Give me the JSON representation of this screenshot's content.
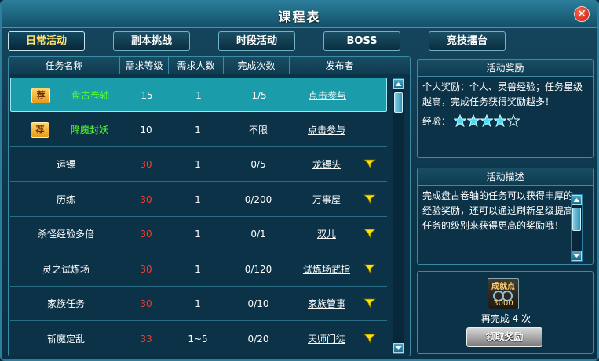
{
  "window": {
    "title": "课程表",
    "close_label": "✕"
  },
  "tabs": [
    {
      "label": "日常活动",
      "active": true
    },
    {
      "label": "副本挑战",
      "active": false
    },
    {
      "label": "时段活动",
      "active": false
    },
    {
      "label": "BOSS",
      "active": false
    },
    {
      "label": "竞技擂台",
      "active": false
    }
  ],
  "table": {
    "columns": [
      "任务名称",
      "需求等级",
      "需求人数",
      "完成次数",
      "发布者"
    ],
    "rows": [
      {
        "badge": "荐",
        "name": "盘古卷轴",
        "level": "15",
        "people": "1",
        "count": "1/5",
        "publisher": "点击参与",
        "flag": false
      },
      {
        "badge": "荐",
        "name": "降魔封妖",
        "level": "10",
        "people": "1",
        "count": "不限",
        "publisher": "点击参与",
        "flag": false
      },
      {
        "name": "运镖",
        "level": "30",
        "people": "1",
        "count": "0/5",
        "publisher": "龙镖头",
        "flag": true
      },
      {
        "name": "历练",
        "level": "30",
        "people": "1",
        "count": "0/200",
        "publisher": "万事屋",
        "flag": true
      },
      {
        "name": "杀怪经验多倍",
        "level": "30",
        "people": "1",
        "count": "0/1",
        "publisher": "双儿",
        "flag": true
      },
      {
        "name": "灵之试炼场",
        "level": "30",
        "people": "1",
        "count": "0/120",
        "publisher": "试炼场武指",
        "flag": true
      },
      {
        "name": "家族任务",
        "level": "30",
        "people": "1",
        "count": "0/10",
        "publisher": "家族管事",
        "flag": true
      },
      {
        "name": "斩魔定乱",
        "level": "33",
        "people": "1~5",
        "count": "0/20",
        "publisher": "天师门徒",
        "flag": true
      }
    ]
  },
  "reward": {
    "title": "活动奖励",
    "text": "个人奖励：个人、灵兽经验；任务星级越高，完成任务获得奖励越多！",
    "exp_label": "经验：",
    "stars": 4,
    "stars_max": 5
  },
  "description": {
    "title": "活动描述",
    "text": "完成盘古卷轴的任务可以获得丰厚的经验奖励，还可以通过刷新星级提高任务的级别来获得更高的奖励哦！"
  },
  "achievement": {
    "label": "成就点",
    "points": "3000",
    "remaining_text": "再完成 4 次",
    "claim_label": "领取奖励"
  },
  "colors": {
    "level_red": "#ff3a2a",
    "name_green": "#52ff2e",
    "selected_row": "#1a9cab"
  }
}
